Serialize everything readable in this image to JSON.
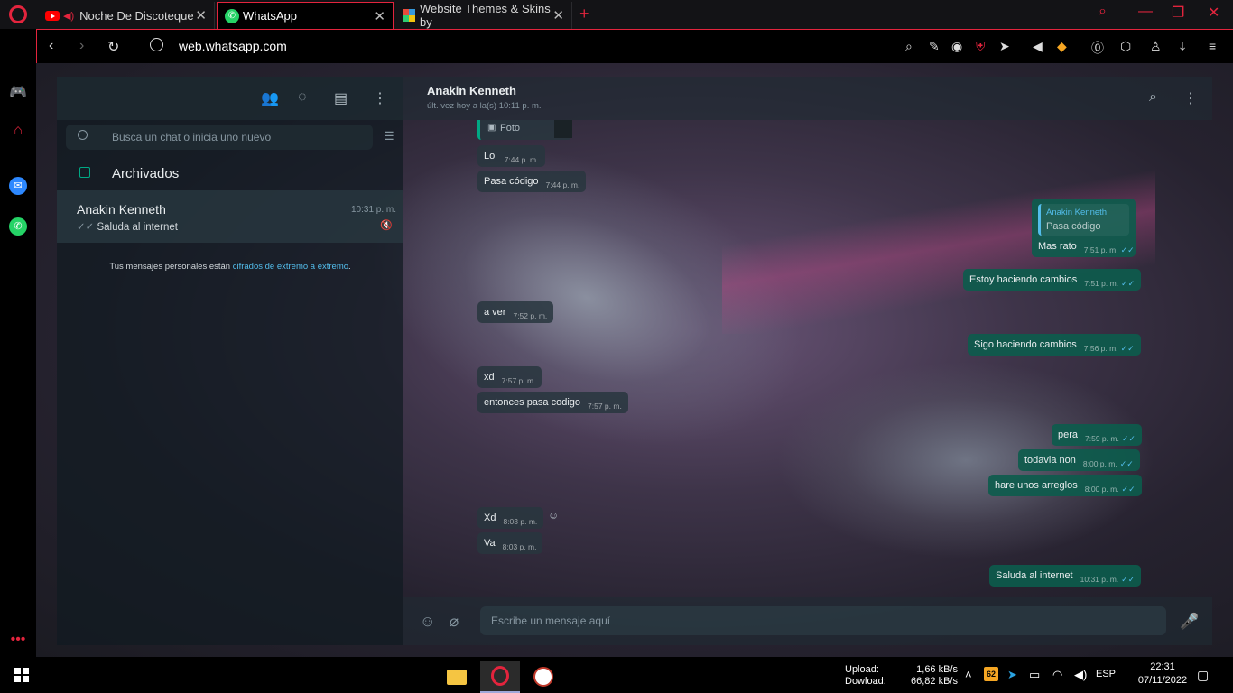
{
  "browser": {
    "tabs": [
      {
        "label": "Noche De Discoteque"
      },
      {
        "label": "WhatsApp"
      },
      {
        "label": "Website Themes & Skins by"
      }
    ],
    "new_tab": "+",
    "url": "web.whatsapp.com",
    "accent": "#e3243d"
  },
  "whatsapp": {
    "search_placeholder": "Busca un chat o inicia uno nuevo",
    "archived_label": "Archivados",
    "chat_list": [
      {
        "name": "Anakin Kenneth",
        "time": "10:31 p. m.",
        "preview": "Saluda al internet"
      }
    ],
    "encryption_text": "Tus mensajes personales están ",
    "encryption_link": "cifrados de extremo a extremo",
    "encryption_end": ".",
    "contact": {
      "name": "Anakin Kenneth",
      "status": "últ. vez hoy a la(s) 10:11 p. m."
    },
    "messages": {
      "photo_caption": "Foto",
      "m1": {
        "text": "Lol",
        "time": "7:44 p. m."
      },
      "m2": {
        "text": "Pasa código",
        "time": "7:44 p. m."
      },
      "m3": {
        "quote_name": "Anakin Kenneth",
        "quote_text": "Pasa código",
        "text": "Mas rato",
        "time": "7:51 p. m."
      },
      "m4": {
        "text": "Estoy haciendo cambios",
        "time": "7:51 p. m."
      },
      "m5": {
        "text": "a ver",
        "time": "7:52 p. m."
      },
      "m6": {
        "text": "Sigo haciendo cambios",
        "time": "7:56 p. m."
      },
      "m7": {
        "text": "xd",
        "time": "7:57 p. m."
      },
      "m8": {
        "text": "entonces pasa codigo",
        "time": "7:57 p. m."
      },
      "m9": {
        "text": "pera",
        "time": "7:59 p. m."
      },
      "m10": {
        "text": "todavia non",
        "time": "8:00 p. m."
      },
      "m11": {
        "text": "hare unos arreglos",
        "time": "8:00 p. m."
      },
      "m12": {
        "text": "Xd",
        "time": "8:03 p. m."
      },
      "m13": {
        "text": "Va",
        "time": "8:03 p. m."
      },
      "m14": {
        "text": "Saluda al internet",
        "time": "10:31 p. m."
      }
    },
    "composer_placeholder": "Escribe un mensaje aquí",
    "colors": {
      "outgoing": "#0c5c4d",
      "incoming": "#28363e",
      "link": "#53bdeb",
      "green": "#00a884"
    }
  },
  "taskbar": {
    "upload_label": "Upload:",
    "download_label": "Dowload:",
    "upload_value": "1,66 kB/s",
    "download_value": "66,82 kB/s",
    "badge": "62",
    "language": "ESP",
    "time": "22:31",
    "date": "07/11/2022"
  }
}
